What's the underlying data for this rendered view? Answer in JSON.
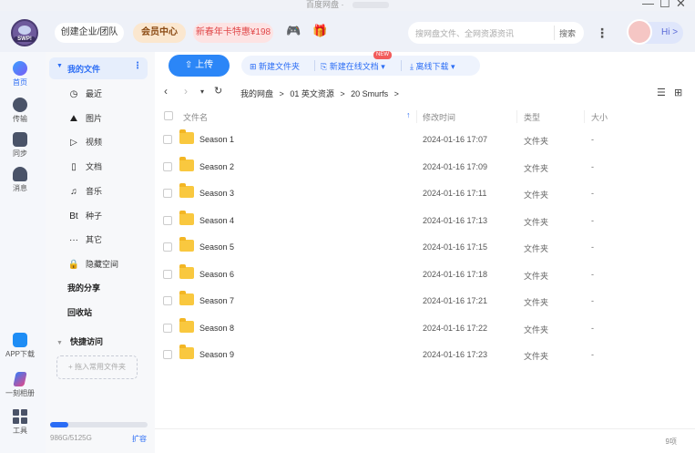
{
  "window": {
    "title": "百度网盘 ·",
    "min": "—",
    "max": "☐",
    "close": "✕"
  },
  "header": {
    "team_label": "创建企业/团队",
    "vip_label": "会员中心",
    "promo_label": "新春年卡特惠¥198",
    "search_placeholder": "搜网盘文件、全网资源资讯",
    "search_button": "搜索",
    "more": "⋮",
    "hi_label": "Hi >",
    "logo_text": "SWP!"
  },
  "rail": {
    "home": "首页",
    "transfer": "传输",
    "sync": "同步",
    "message": "消息",
    "app_download": "APP下载",
    "kuai": "一刻相册",
    "tools": "工具"
  },
  "sidebar": {
    "my_files": "我的文件",
    "items": [
      {
        "icon": "◷",
        "label": "最近"
      },
      {
        "icon": "⛰",
        "label": "图片"
      },
      {
        "icon": "▷",
        "label": "视频"
      },
      {
        "icon": "▯",
        "label": "文档"
      },
      {
        "icon": "♫",
        "label": "音乐"
      },
      {
        "icon": "Bt",
        "label": "种子"
      },
      {
        "icon": "···",
        "label": "其它"
      },
      {
        "icon": "🔒",
        "label": "隐藏空间"
      }
    ],
    "my_share": "我的分享",
    "recycle": "回收站",
    "quick_access": "快捷访问",
    "drop_hint": "+ 拖入常用文件夹",
    "storage_text": "986G/5125G",
    "storage_used": 0.19,
    "expand": "扩容"
  },
  "toolbar": {
    "upload": "上传",
    "new_folder": "新建文件夹",
    "new_doc": "新建在线文档",
    "new_badge": "NEW",
    "offline": "离线下载"
  },
  "breadcrumb": [
    "我的网盘",
    ">",
    "01 英文资源",
    ">",
    "20 Smurfs",
    ">"
  ],
  "columns": {
    "name": "文件名",
    "modified": "修改时间",
    "type": "类型",
    "size": "大小"
  },
  "files": [
    {
      "name": "Season 1",
      "time": "2024-01-16 17:07",
      "type": "文件夹",
      "size": "-"
    },
    {
      "name": "Season 2",
      "time": "2024-01-16 17:09",
      "type": "文件夹",
      "size": "-"
    },
    {
      "name": "Season 3",
      "time": "2024-01-16 17:11",
      "type": "文件夹",
      "size": "-"
    },
    {
      "name": "Season 4",
      "time": "2024-01-16 17:13",
      "type": "文件夹",
      "size": "-"
    },
    {
      "name": "Season 5",
      "time": "2024-01-16 17:15",
      "type": "文件夹",
      "size": "-"
    },
    {
      "name": "Season 6",
      "time": "2024-01-16 17:18",
      "type": "文件夹",
      "size": "-"
    },
    {
      "name": "Season 7",
      "time": "2024-01-16 17:21",
      "type": "文件夹",
      "size": "-"
    },
    {
      "name": "Season 8",
      "time": "2024-01-16 17:22",
      "type": "文件夹",
      "size": "-"
    },
    {
      "name": "Season 9",
      "time": "2024-01-16 17:23",
      "type": "文件夹",
      "size": "-"
    }
  ],
  "status": {
    "count": "9项"
  },
  "colors": {
    "accent": "#2b6df5",
    "folder": "#f9c83f"
  }
}
